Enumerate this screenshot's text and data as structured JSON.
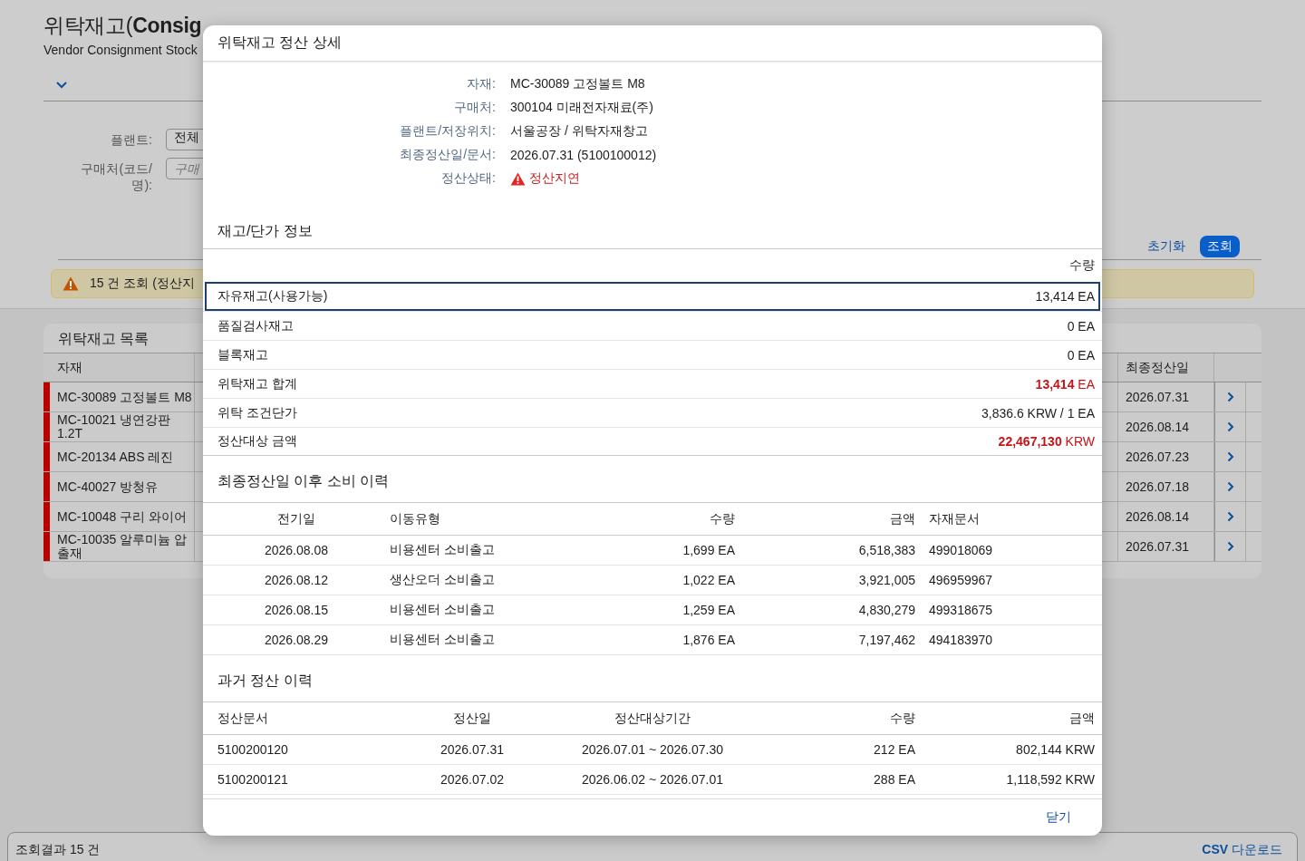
{
  "page": {
    "title": "위탁재고(**Consig**",
    "subtitle": "Vendor Consignment Stock"
  },
  "filters": [
    {
      "label": "플랜트:",
      "value": "전체"
    },
    {
      "label": "구매처(코드/명):",
      "placeholder": "구매"
    }
  ],
  "actions": [
    {
      "label": "초기화",
      "kind": "link"
    },
    {
      "label": "조회",
      "kind": "primary"
    }
  ],
  "message": {
    "text": "15 건 조회 (정산지",
    "warning": true
  },
  "list": {
    "title": "위탁재고 목록",
    "columns": [
      "자재",
      "최종정산일"
    ],
    "rows": [
      {
        "material": "MC-30089 고정볼트 M8",
        "last_settlement": "2026.07.31",
        "color": "#bb0000"
      },
      {
        "material": "MC-10021 냉연강판 1.2T",
        "last_settlement": "2026.08.14",
        "color": "#bb0000"
      },
      {
        "material": "MC-20134 ABS 레진",
        "last_settlement": "2026.07.23",
        "color": "#bb0000"
      },
      {
        "material": "MC-40027 방청유",
        "last_settlement": "2026.07.18",
        "color": "#bb0000"
      },
      {
        "material": "MC-10048 구리 와이어",
        "last_settlement": "2026.08.14",
        "color": "#bb0000"
      },
      {
        "material": "MC-10035 알루미늄 압출재",
        "last_settlement": "2026.07.31",
        "color": "#bb0000"
      }
    ]
  },
  "status_bar": {
    "text": "조회결과 15 건",
    "action": "**CSV** 다운로드"
  },
  "dialog": {
    "title": "위탁재고 정산 상세",
    "info": [
      {
        "label": "자재:",
        "value": "MC-30089 고정볼트 M8",
        "error": false
      },
      {
        "label": "구매처:",
        "value": "300104 미래전자재료(주)",
        "error": false
      },
      {
        "label": "플랜트/저장위치:",
        "value": "서울공장 / 위탁자재창고",
        "error": false
      },
      {
        "label": "최종정산일/문서:",
        "value": "2026.07.31 (5100100012)",
        "error": false
      },
      {
        "label": "정산상태:",
        "value": "정산지연",
        "error": true
      }
    ],
    "stock": {
      "title": "재고/단가 정보",
      "column": "수량",
      "rows": [
        {
          "label": "자유재고(사용가능)",
          "value": "13,414 EA",
          "emphasis": false,
          "selected": true
        },
        {
          "label": "품질검사재고",
          "value": "0 EA",
          "emphasis": false,
          "selected": false
        },
        {
          "label": "블록재고",
          "value": "0 EA",
          "emphasis": false,
          "selected": false
        },
        {
          "label": "위탁재고 합계",
          "value": "**13,414** EA",
          "emphasis": true,
          "selected": false
        },
        {
          "label": "위탁 조건단가",
          "value": "3,836.6 KRW / 1 EA",
          "emphasis": false,
          "selected": false
        },
        {
          "label": "정산대상 금액",
          "value": "**22,467,130** KRW",
          "emphasis": true,
          "selected": false
        }
      ]
    },
    "consumption": {
      "title": "최종정산일 이후 소비 이력",
      "columns": [
        "전기일",
        "이동유형",
        "수량",
        "금액",
        "자재문서"
      ],
      "rows": [
        [
          "2026.08.08",
          "비용센터 소비출고",
          "1,699 EA",
          "6,518,383",
          "499018069"
        ],
        [
          "2026.08.12",
          "생산오더 소비출고",
          "1,022 EA",
          "3,921,005",
          "496959967"
        ],
        [
          "2026.08.15",
          "비용센터 소비출고",
          "1,259 EA",
          "4,830,279",
          "499318675"
        ],
        [
          "2026.08.29",
          "비용센터 소비출고",
          "1,876 EA",
          "7,197,462",
          "494183970"
        ]
      ]
    },
    "history": {
      "title": "과거 정산 이력",
      "columns": [
        "정산문서",
        "정산일",
        "정산대상기간",
        "수량",
        "금액"
      ],
      "rows": [
        [
          "5100200120",
          "2026.07.31",
          "2026.07.01 ~ 2026.07.30",
          "212 EA",
          "802,144 KRW"
        ],
        [
          "5100200121",
          "2026.07.02",
          "2026.06.02 ~ 2026.07.01",
          "288 EA",
          "1,118,592 KRW"
        ]
      ]
    },
    "close": "닫기"
  }
}
